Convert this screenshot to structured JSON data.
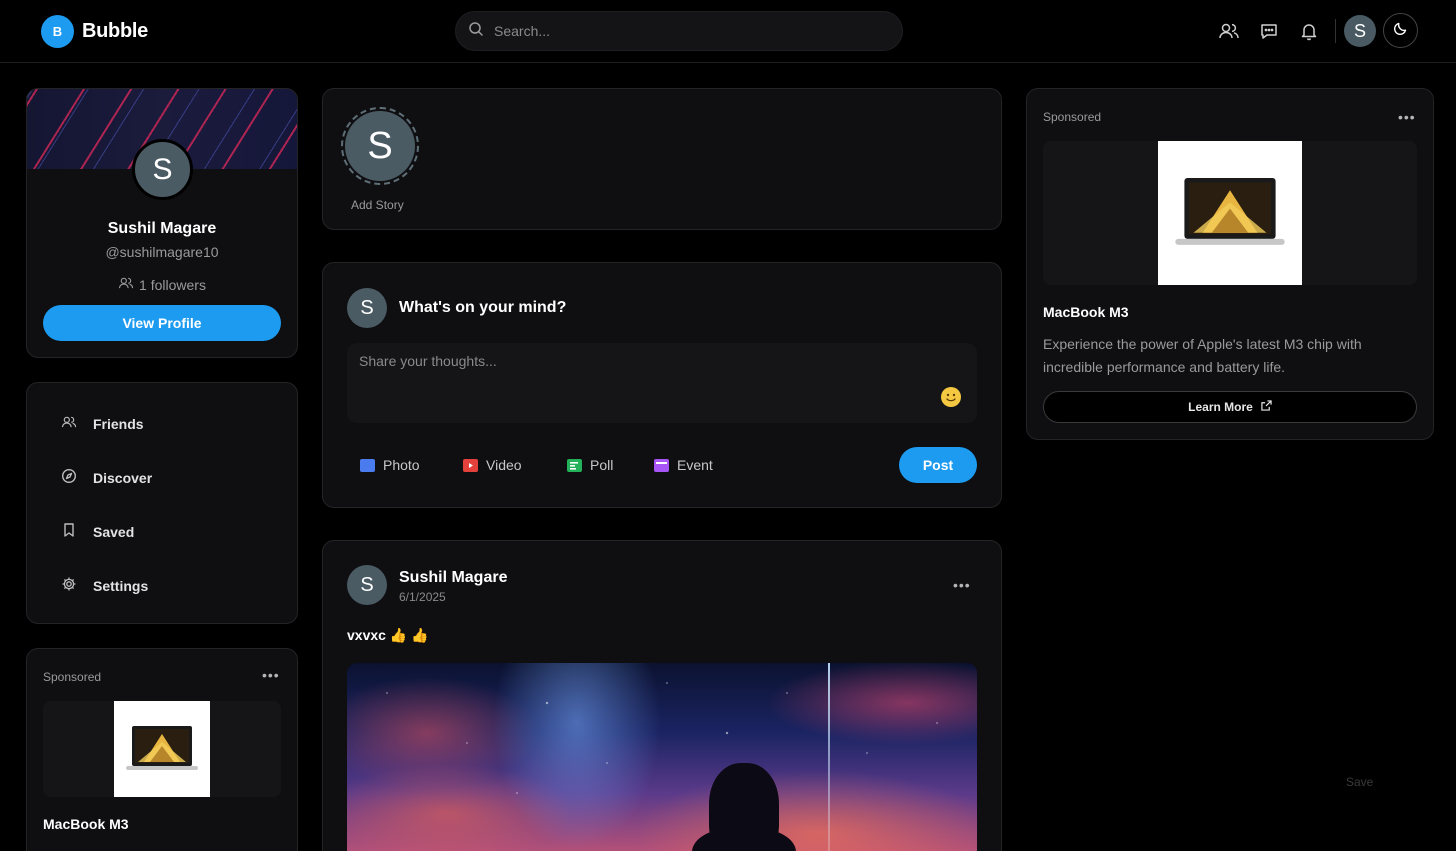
{
  "header": {
    "brand_letter": "B",
    "brand_name": "Bubble",
    "search_placeholder": "Search...",
    "avatar_letter": "S",
    "icons": [
      "users-icon",
      "chat-icon",
      "bell-icon",
      "moon-icon"
    ]
  },
  "profile": {
    "avatar_letter": "S",
    "name": "Sushil Magare",
    "handle": "@sushilmagare10",
    "followers": "1 followers",
    "view_profile": "View Profile"
  },
  "nav": {
    "items": [
      {
        "label": "Friends",
        "icon": "users-icon"
      },
      {
        "label": "Discover",
        "icon": "compass-icon"
      },
      {
        "label": "Saved",
        "icon": "bookmark-icon"
      },
      {
        "label": "Settings",
        "icon": "gear-icon"
      }
    ]
  },
  "ad_left": {
    "label": "Sponsored",
    "title": "MacBook M3"
  },
  "story": {
    "avatar_letter": "S",
    "label": "Add Story"
  },
  "composer": {
    "avatar_letter": "S",
    "prompt": "What's on your mind?",
    "placeholder": "Share your thoughts...",
    "photo": "Photo",
    "video": "Video",
    "poll": "Poll",
    "event": "Event",
    "post": "Post",
    "colors": {
      "photo": "#4a7cf0",
      "video": "#e5413c",
      "poll": "#23b15a",
      "event": "#a855f7"
    }
  },
  "post": {
    "avatar_letter": "S",
    "author": "Sushil Magare",
    "date": "6/1/2025",
    "text": "vxvxc 👍 👍"
  },
  "ad_right": {
    "label": "Sponsored",
    "title": "MacBook M3",
    "description": "Experience the power of Apple's latest M3 chip with incredible performance and battery life.",
    "cta": "Learn More"
  },
  "floating_save": "Save",
  "colors": {
    "accent": "#1d9bf0",
    "background": "#000000",
    "card": "#0f0f11"
  }
}
